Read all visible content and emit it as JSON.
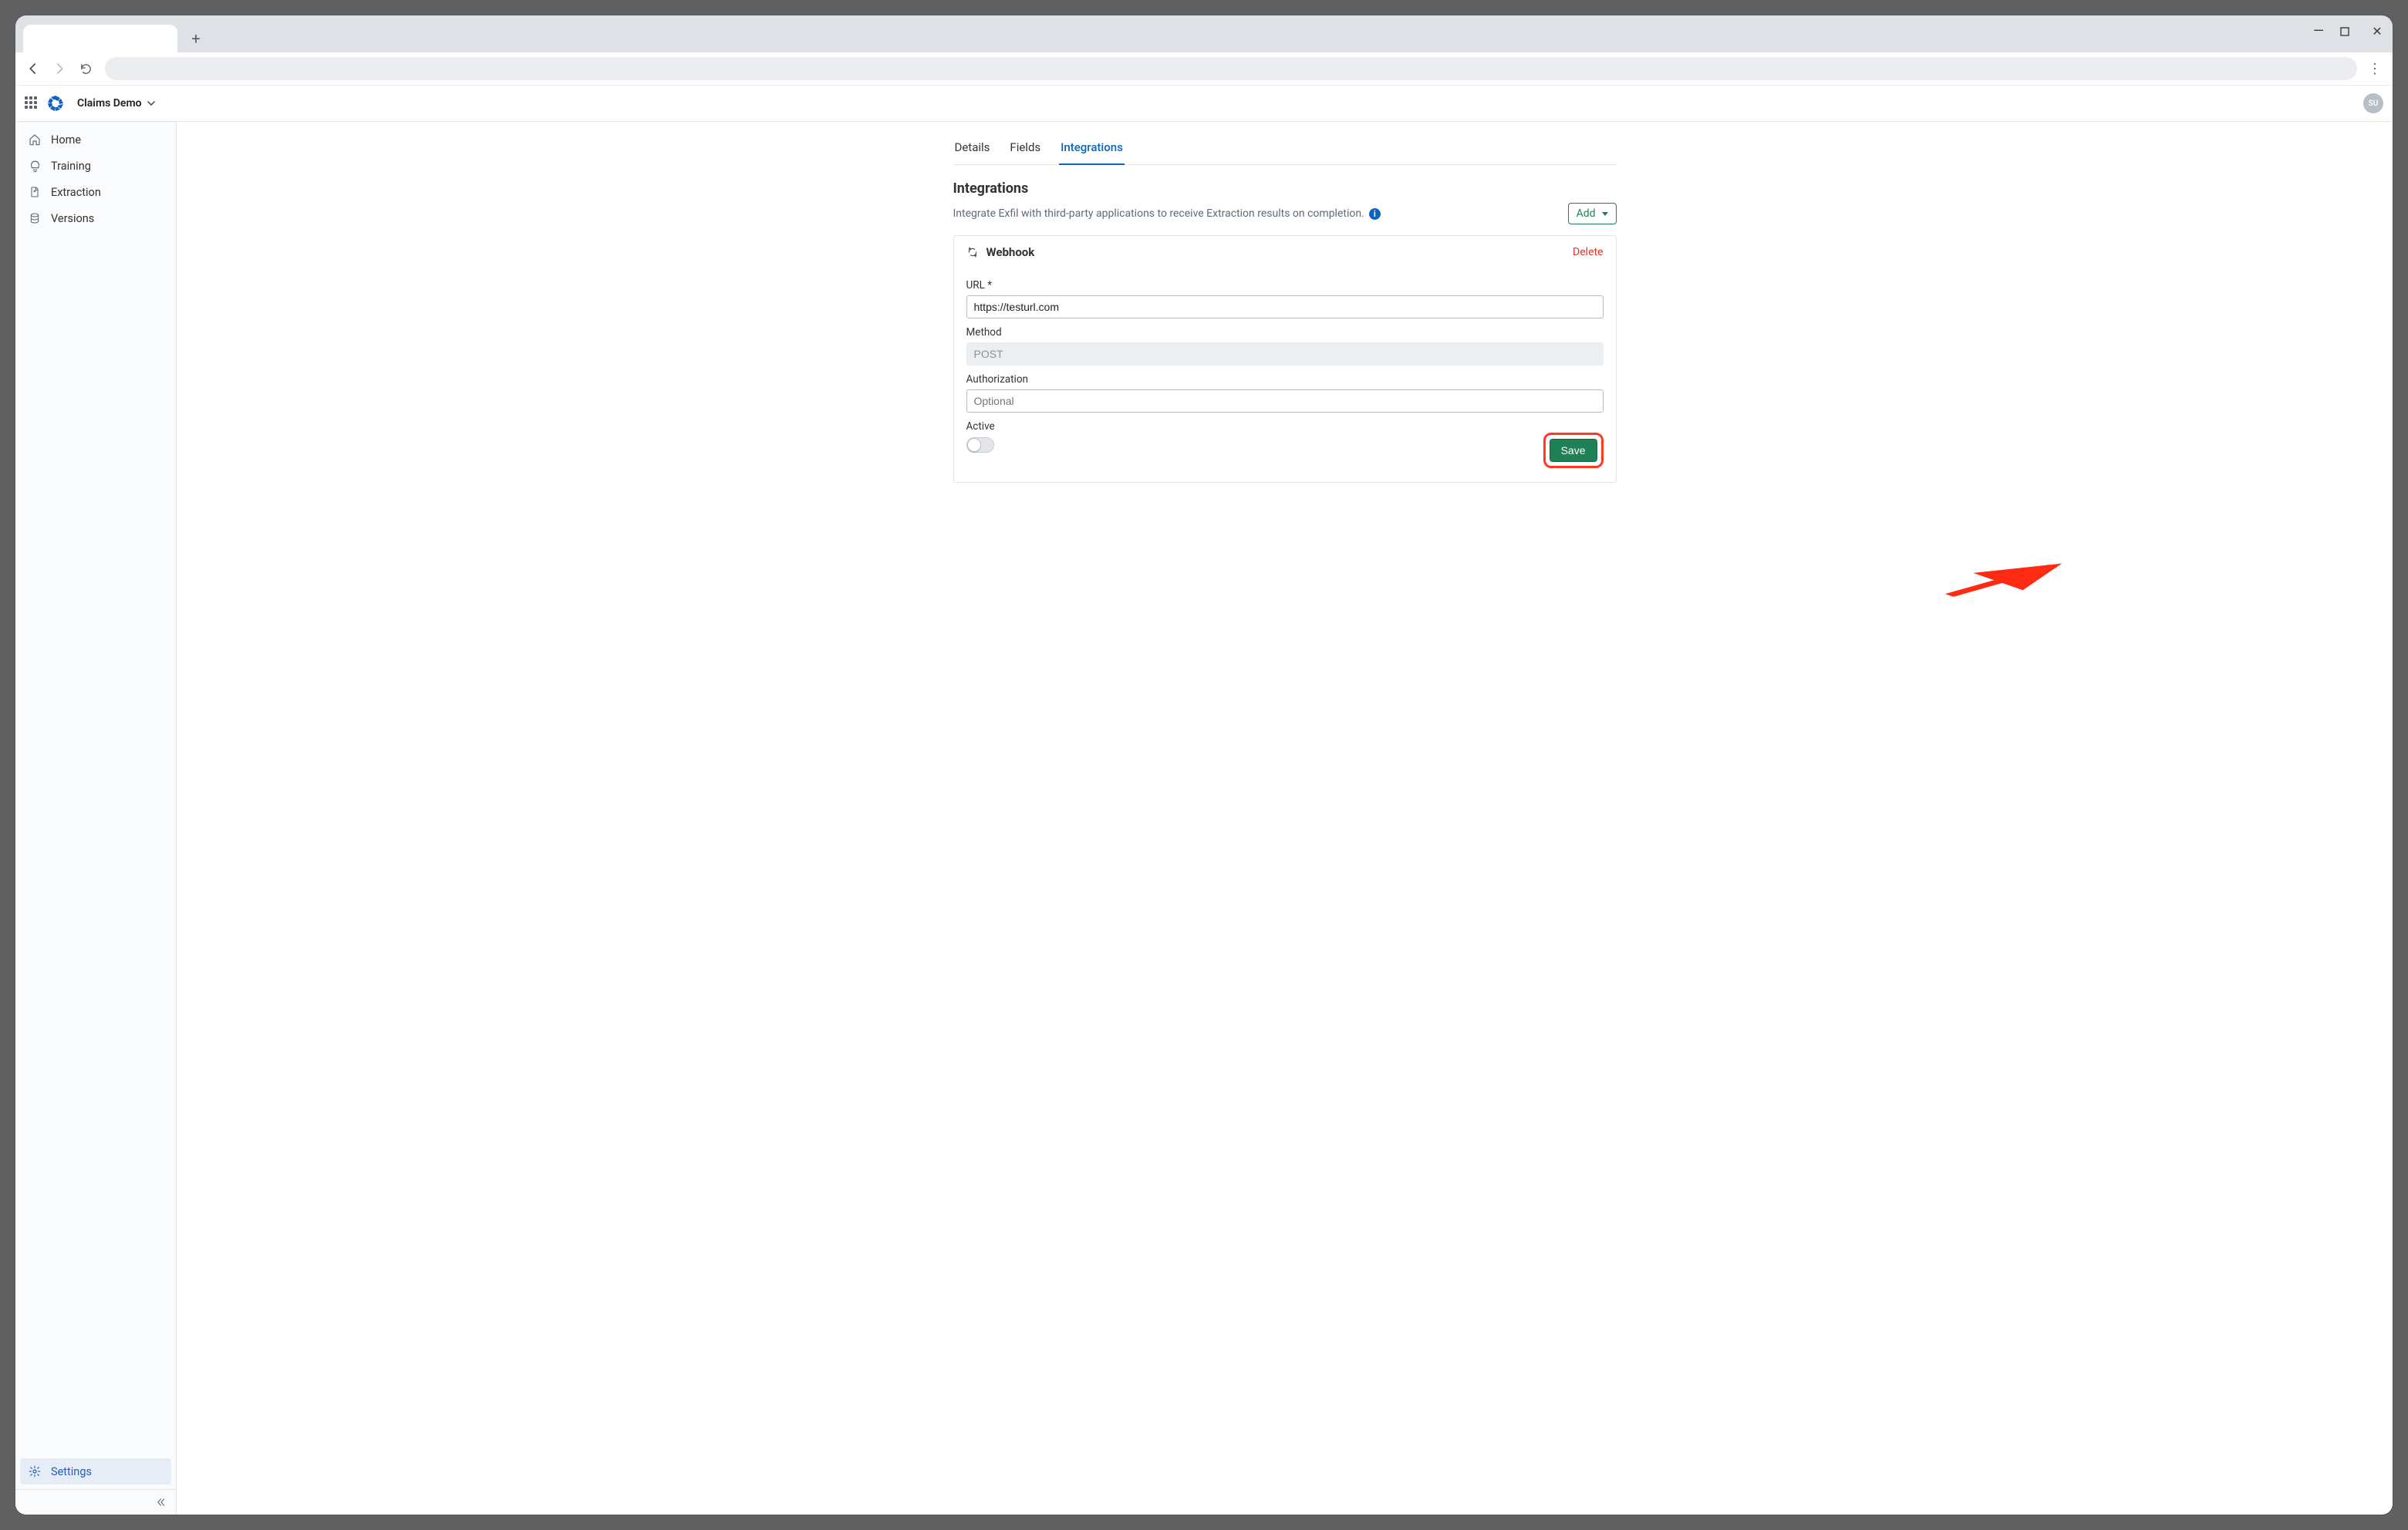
{
  "window_controls": {
    "minimize": "—",
    "maximize": "☐",
    "close": "✕"
  },
  "appbar": {
    "project_name": "Claims Demo",
    "avatar_initials": "SU"
  },
  "sidebar": {
    "items": [
      {
        "label": "Home"
      },
      {
        "label": "Training"
      },
      {
        "label": "Extraction"
      },
      {
        "label": "Versions"
      }
    ],
    "settings_label": "Settings"
  },
  "tabs": {
    "details": "Details",
    "fields": "Fields",
    "integrations": "Integrations"
  },
  "page": {
    "heading": "Integrations",
    "description": "Integrate Exfil with third-party applications to receive Extraction results on completion.",
    "add_label": "Add"
  },
  "webhook": {
    "title": "Webhook",
    "delete_label": "Delete",
    "url_label": "URL *",
    "url_value": "https://testurl.com",
    "method_label": "Method",
    "method_value": "POST",
    "auth_label": "Authorization",
    "auth_placeholder": "Optional",
    "active_label": "Active",
    "save_label": "Save"
  }
}
